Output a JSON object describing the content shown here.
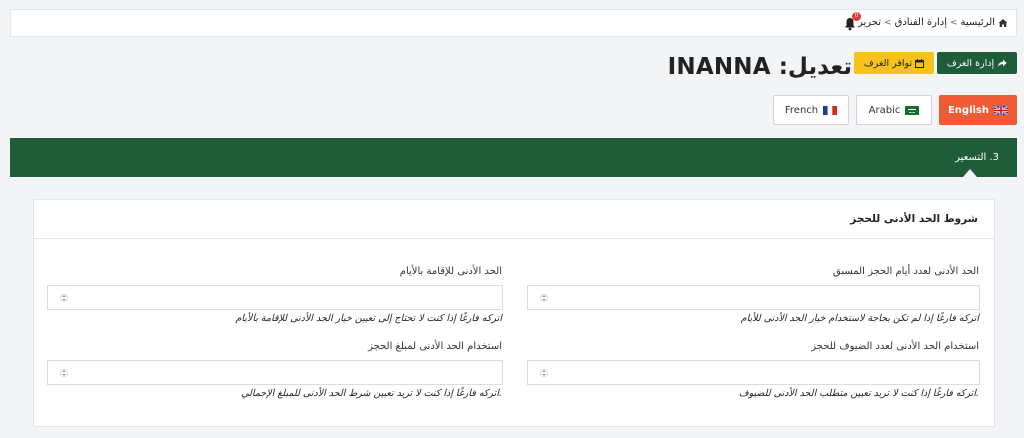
{
  "breadcrumb": {
    "home": "الرئيسية",
    "hotels": "إدارة الفنادق",
    "current": "تحرير",
    "separator": "<"
  },
  "notifications": {
    "count": "0"
  },
  "header": {
    "title": "تعديل: INANNA",
    "rooms_button": "إدارة الغرف",
    "availability_button": "توافر الغرف"
  },
  "languages": {
    "english": "English",
    "arabic": "Arabic",
    "french": "French"
  },
  "tab": {
    "label": "3. التسعير"
  },
  "section": {
    "title": "شروط الحد الأدنى للحجز",
    "fields": {
      "advance_days": {
        "label": "الحد الأدنى لعدد أيام الحجز المسبق",
        "value": "",
        "help": "اتركه فارغًا إذا لم تكن بحاجة لاستخدام خيار الحد الأدنى للأيام"
      },
      "min_stay": {
        "label": "الحد الأدنى للإقامة بالأيام",
        "value": "",
        "help": "اتركه فارغًا إذا كنت لا تحتاج إلى تعيين خيار الحد الأدنى للإقامة بالأيام"
      },
      "min_guests": {
        "label": "استخدام الحد الأدنى لعدد الضيوف للحجز",
        "value": "",
        "help": "اتركه فارغًا إذا كنت لا تريد تعيين متطلب الحد الأدنى للضيوف."
      },
      "min_amount": {
        "label": "استخدام الحد الأدنى لمبلغ الحجز",
        "value": "",
        "help": "اتركه فارغًا إذا كنت لا تريد تعيين شرط الحد الأدنى للمبلغ الإجمالي."
      }
    }
  },
  "colors": {
    "brand_green": "#1e5c3a",
    "accent_orange": "#ef5b35",
    "accent_yellow": "#f6c21b"
  },
  "icons": {
    "home": "home-icon",
    "bell": "bell-icon",
    "rooms": "share-icon",
    "availability": "calendar-icon",
    "spinner": "spinner-arrows-icon"
  }
}
